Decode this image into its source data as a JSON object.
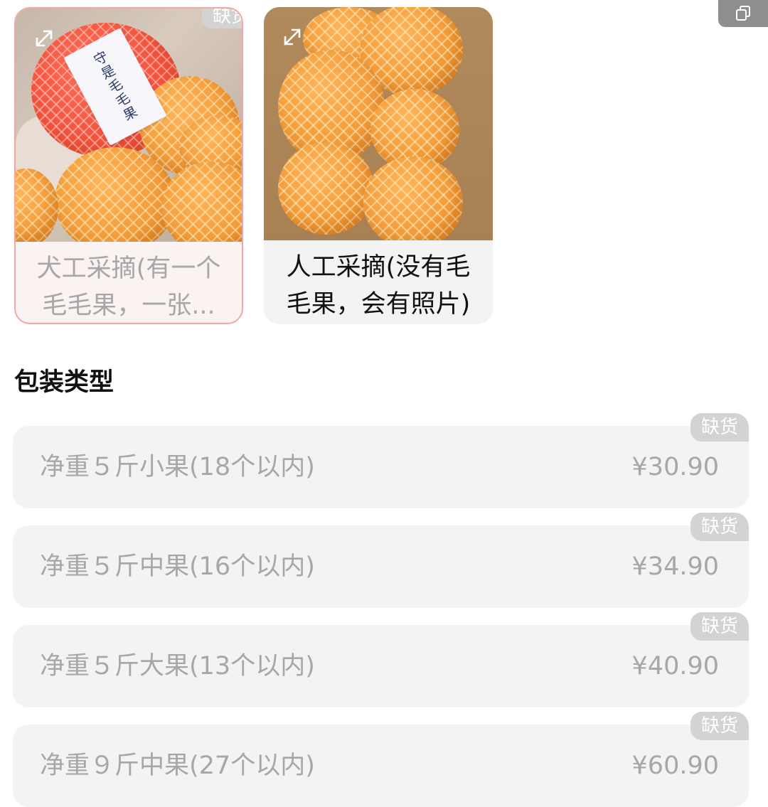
{
  "variants": [
    {
      "label": "犬工采摘(有一个毛毛果，一张...",
      "photo_note": "守是毛毛果",
      "badge": "缺货",
      "selected": true,
      "out_of_stock": true
    },
    {
      "label": "人工采摘(没有毛毛果，会有照片)",
      "selected": false,
      "out_of_stock": false
    }
  ],
  "packaging": {
    "title": "包装类型",
    "options": [
      {
        "label": "净重５斤小果(18个以内)",
        "price": "¥30.90",
        "badge": "缺货"
      },
      {
        "label": "净重５斤中果(16个以内)",
        "price": "¥34.90",
        "badge": "缺货"
      },
      {
        "label": "净重５斤大果(13个以内)",
        "price": "¥40.90",
        "badge": "缺货"
      },
      {
        "label": "净重９斤中果(27个以内)",
        "price": "¥60.90",
        "badge": "缺货"
      }
    ]
  },
  "icons": {
    "expand": "expand-arrows-icon",
    "copy": "copy-window-icon"
  },
  "colors": {
    "selected_border": "#f2a7a3",
    "option_background": "#f3f3f4",
    "disabled_text": "#a7a7a7",
    "badge_background": "#d3d3d3"
  }
}
